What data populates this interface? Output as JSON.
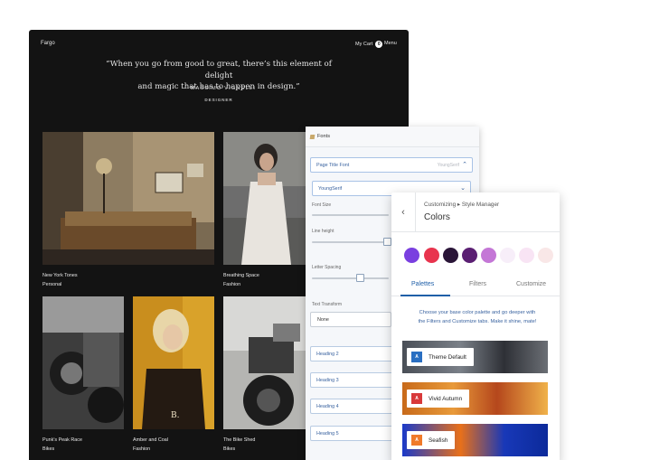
{
  "site": {
    "brand": "Fargo",
    "cart_label": "My Cart",
    "cart_count": "0",
    "menu_label": "Menu",
    "quote_line1": "“When you go from good to great, there’s this element of delight",
    "quote_line2": "and magic that has to happen in design.”",
    "author": "— MASSIMO VIGNELLI",
    "author_role": "DESIGNER",
    "projects": [
      {
        "title": "New York Tones",
        "category": "Personal"
      },
      {
        "title": "Breathing Space",
        "category": "Fashion"
      },
      {
        "title": "Punk’s Peak Race",
        "category": "Bikes"
      },
      {
        "title": "Amber and Coal",
        "category": "Fashion"
      },
      {
        "title": "The Bike Shed",
        "category": "Bikes"
      }
    ]
  },
  "fonts_panel": {
    "title": "Fonts",
    "page_title_font_label": "Page Title Font",
    "page_title_font_value": "YoungSerif",
    "font_family_value": "YoungSerif",
    "font_size_label": "Font Size",
    "line_height_label": "Line height",
    "letter_spacing_label": "Letter Spacing",
    "text_transform_label": "Text Transform",
    "text_transform_value": "None",
    "headings": [
      "Heading 2",
      "Heading 3",
      "Heading 4",
      "Heading 5"
    ]
  },
  "style_manager": {
    "breadcrumb": "Customizing ▸ Style Manager",
    "title": "Colors",
    "swatches": [
      "#7a3fe0",
      "#e8344e",
      "#2a1538",
      "#5b1f73",
      "#c477d6",
      "#f7eef9",
      "#f8e4f4",
      "#f9e7e7"
    ],
    "tabs": [
      "Palettes",
      "Filters",
      "Customize"
    ],
    "active_tab": "Palettes",
    "description_1": "Choose your base color palette and go deeper with",
    "description_2": "the Filters and Customize tabs. Make it shine, mate!",
    "palettes": [
      {
        "name": "Theme Default",
        "badge": "A",
        "badge_color": "#2a6fc2"
      },
      {
        "name": "Vivid Autumn",
        "badge": "A",
        "badge_color": "#d8393a"
      },
      {
        "name": "Seafish",
        "badge": "A",
        "badge_color": "#f07a2a"
      }
    ]
  }
}
